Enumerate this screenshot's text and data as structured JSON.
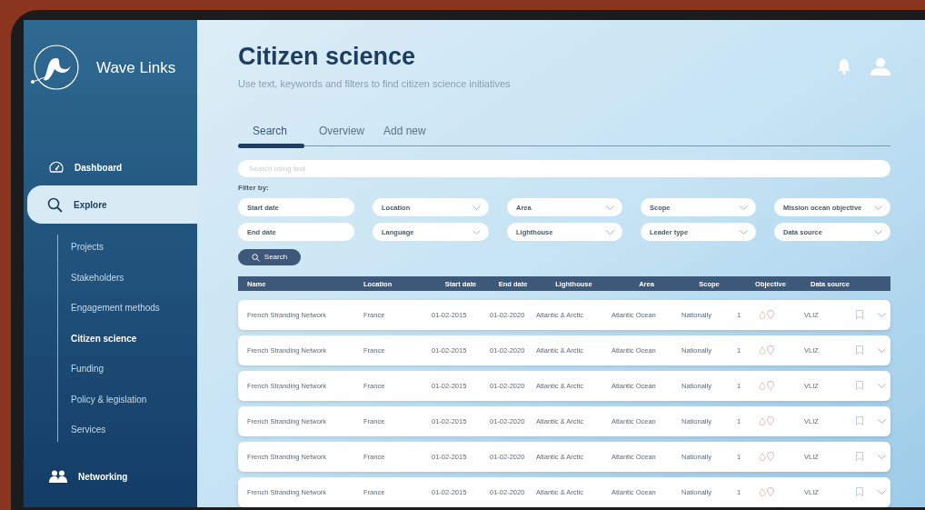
{
  "app": {
    "name": "Wave Links"
  },
  "sidebar": {
    "items": [
      {
        "label": "Dashboard",
        "selected": false
      },
      {
        "label": "Explore",
        "selected": true,
        "children": [
          {
            "label": "Projects",
            "selected": false
          },
          {
            "label": "Stakeholders",
            "selected": false
          },
          {
            "label": "Engagement methods",
            "selected": false
          },
          {
            "label": "Citizen science",
            "selected": true
          },
          {
            "label": "Funding",
            "selected": false
          },
          {
            "label": "Policy & legislation",
            "selected": false
          },
          {
            "label": "Services",
            "selected": false
          }
        ]
      },
      {
        "label": "Networking",
        "selected": false
      }
    ]
  },
  "header": {
    "title": "Citizen science",
    "subtitle": "Use text, keywords and filters to find citizen science initiatives"
  },
  "tabs": [
    {
      "label": "Search",
      "selected": true
    },
    {
      "label": "Overview",
      "selected": false
    },
    {
      "label": "Add new",
      "selected": false
    }
  ],
  "search": {
    "placeholder": "Search using text"
  },
  "filters": {
    "label": "Filter by:",
    "items": [
      {
        "label": "Start date",
        "kind": "text"
      },
      {
        "label": "Location",
        "kind": "dropdown"
      },
      {
        "label": "Area",
        "kind": "dropdown"
      },
      {
        "label": "Scope",
        "kind": "dropdown"
      },
      {
        "label": "Mission ocean objective",
        "kind": "dropdown"
      },
      {
        "label": "End date",
        "kind": "text"
      },
      {
        "label": "Language",
        "kind": "dropdown"
      },
      {
        "label": "Lighthouse",
        "kind": "dropdown"
      },
      {
        "label": "Leader type",
        "kind": "dropdown"
      },
      {
        "label": "Data source",
        "kind": "dropdown"
      }
    ]
  },
  "search_button": "Search",
  "table": {
    "columns": [
      "Name",
      "Location",
      "Start date",
      "End date",
      "Lighthouse",
      "Area",
      "Scope",
      "Objective",
      "Data source"
    ],
    "rows": [
      [
        "French Stranding Network",
        "France",
        "01-02-2015",
        "01-02-2020",
        "Atlantic & Arctic",
        "Atlantic Ocean",
        "Nationally",
        "1",
        "VLIZ"
      ],
      [
        "French Stranding Network",
        "France",
        "01-02-2015",
        "01-02-2020",
        "Atlantic & Arctic",
        "Atlantic Ocean",
        "Nationally",
        "1",
        "VLIZ"
      ],
      [
        "French Stranding Network",
        "France",
        "01-02-2015",
        "01-02-2020",
        "Atlantic & Arctic",
        "Atlantic Ocean",
        "Nationally",
        "1",
        "VLIZ"
      ],
      [
        "French Stranding Network",
        "France",
        "01-02-2015",
        "01-02-2020",
        "Atlantic & Arctic",
        "Atlantic Ocean",
        "Nationally",
        "1",
        "VLIZ"
      ],
      [
        "French Stranding Network",
        "France",
        "01-02-2015",
        "01-02-2020",
        "Atlantic & Arctic",
        "Atlantic Ocean",
        "Nationally",
        "1",
        "VLIZ"
      ],
      [
        "French Stranding Network",
        "France",
        "01-02-2015",
        "01-02-2020",
        "Atlantic & Arctic",
        "Atlantic Ocean",
        "Nationally",
        "1",
        "VLIZ"
      ]
    ]
  }
}
